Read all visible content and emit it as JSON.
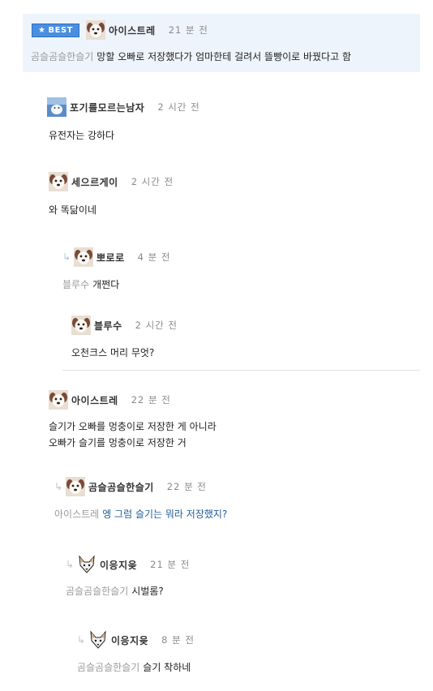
{
  "best_comment": {
    "badge_label": "BEST",
    "author": "아이스트레",
    "time": "21 분 전",
    "mention": "곰슬곰슬한슬기",
    "text": "망할 오빠로 저장했다가 엄마한테 걸려서 뜰빵이로 바꿨다고 함"
  },
  "comments": [
    {
      "author": "포기를모르는남자",
      "time": "2 시간 전",
      "text": "유전자는 강하다"
    },
    {
      "author": "세으르게이",
      "time": "2 시간 전",
      "text": "와 똑닮이네"
    },
    {
      "author": "뽀로로",
      "time": "4 분 전",
      "mention": "블루수",
      "text": "개쩐다"
    },
    {
      "author": "블루수",
      "time": "2 시간 전",
      "text": "오천크스 머리 무엇?"
    },
    {
      "author": "아이스트레",
      "time": "22 분 전",
      "text_line1": "슬기가 오빠를 멍충이로 저장한 게 아니라",
      "text_line2": "오빠가 슬기를 멍충이로 저장한 거"
    },
    {
      "author": "곰슬곰슬한슬기",
      "time": "22 분 전",
      "mention": "아이스트레",
      "text": "엥 그럼 슬기는 뭐라 저장했지?"
    },
    {
      "author": "이응지읒",
      "time": "21 분 전",
      "mention": "곰슬곰슬한슬기",
      "text": "시벌롬?"
    },
    {
      "author": "이응지읒",
      "time": "8 분 전",
      "mention": "곰슬곰슬한슬기",
      "text": "슬기 착하네"
    }
  ],
  "icons": {
    "avatar_default": "white-dog-avatar",
    "avatar_fox": "fox-face-avatar",
    "avatar_blue": "snow-photo-avatar",
    "reply": "reply-arrow-icon",
    "star": "star-icon"
  },
  "colors": {
    "best_bg": "#eef4fc",
    "best_badge": "#4a8ee0",
    "mention": "#9a9a9a",
    "reply_text_blue": "#1f5d99"
  }
}
